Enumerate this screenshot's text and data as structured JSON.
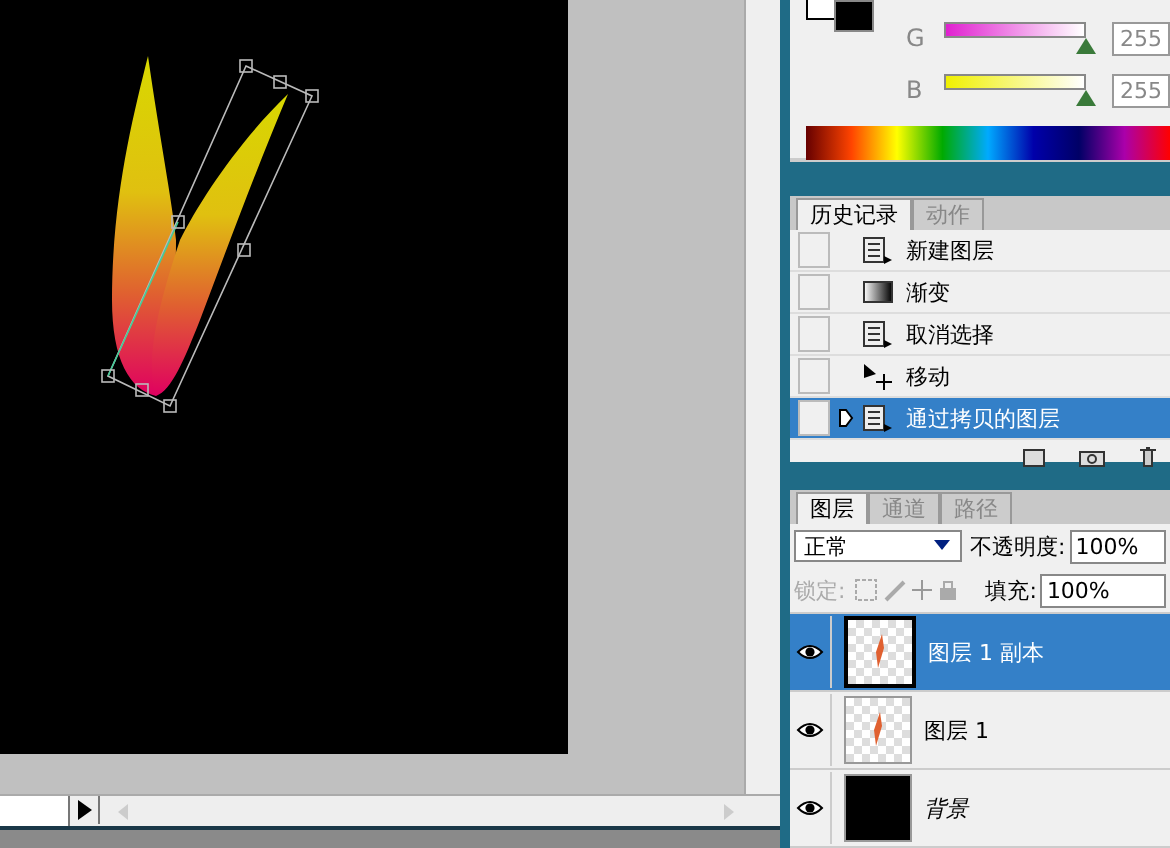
{
  "color_panel": {
    "channels": [
      {
        "label": "G",
        "value": "255",
        "level": 1,
        "kind": "magenta"
      },
      {
        "label": "B",
        "value": "255",
        "level": 1,
        "kind": "yellow"
      }
    ]
  },
  "history_panel": {
    "tabs": [
      {
        "label": "历史记录",
        "selected": true
      },
      {
        "label": "动作",
        "selected": false
      }
    ],
    "items": [
      {
        "label": "新建图层",
        "kind": "document",
        "selected": false
      },
      {
        "label": "渐变",
        "kind": "gradient",
        "selected": false
      },
      {
        "label": "取消选择",
        "kind": "document",
        "selected": false
      },
      {
        "label": "移动",
        "kind": "move",
        "selected": false
      },
      {
        "label": "通过拷贝的图层",
        "kind": "document",
        "selected": true
      }
    ]
  },
  "layers_panel": {
    "tabs": [
      {
        "label": "图层",
        "selected": true
      },
      {
        "label": "通道",
        "selected": false
      },
      {
        "label": "路径",
        "selected": false
      }
    ],
    "blend_mode": "正常",
    "opacity_label": "不透明度:",
    "opacity": "100%",
    "lock_label": "锁定:",
    "fill_label": "填充:",
    "fill": "100%",
    "layers": [
      {
        "name": "图层 1 副本",
        "kind": "transparent",
        "visible": true,
        "selected": true
      },
      {
        "name": "图层 1",
        "kind": "transparent",
        "visible": true,
        "selected": false
      },
      {
        "name": "背景",
        "kind": "background",
        "visible": true,
        "selected": false
      }
    ]
  }
}
